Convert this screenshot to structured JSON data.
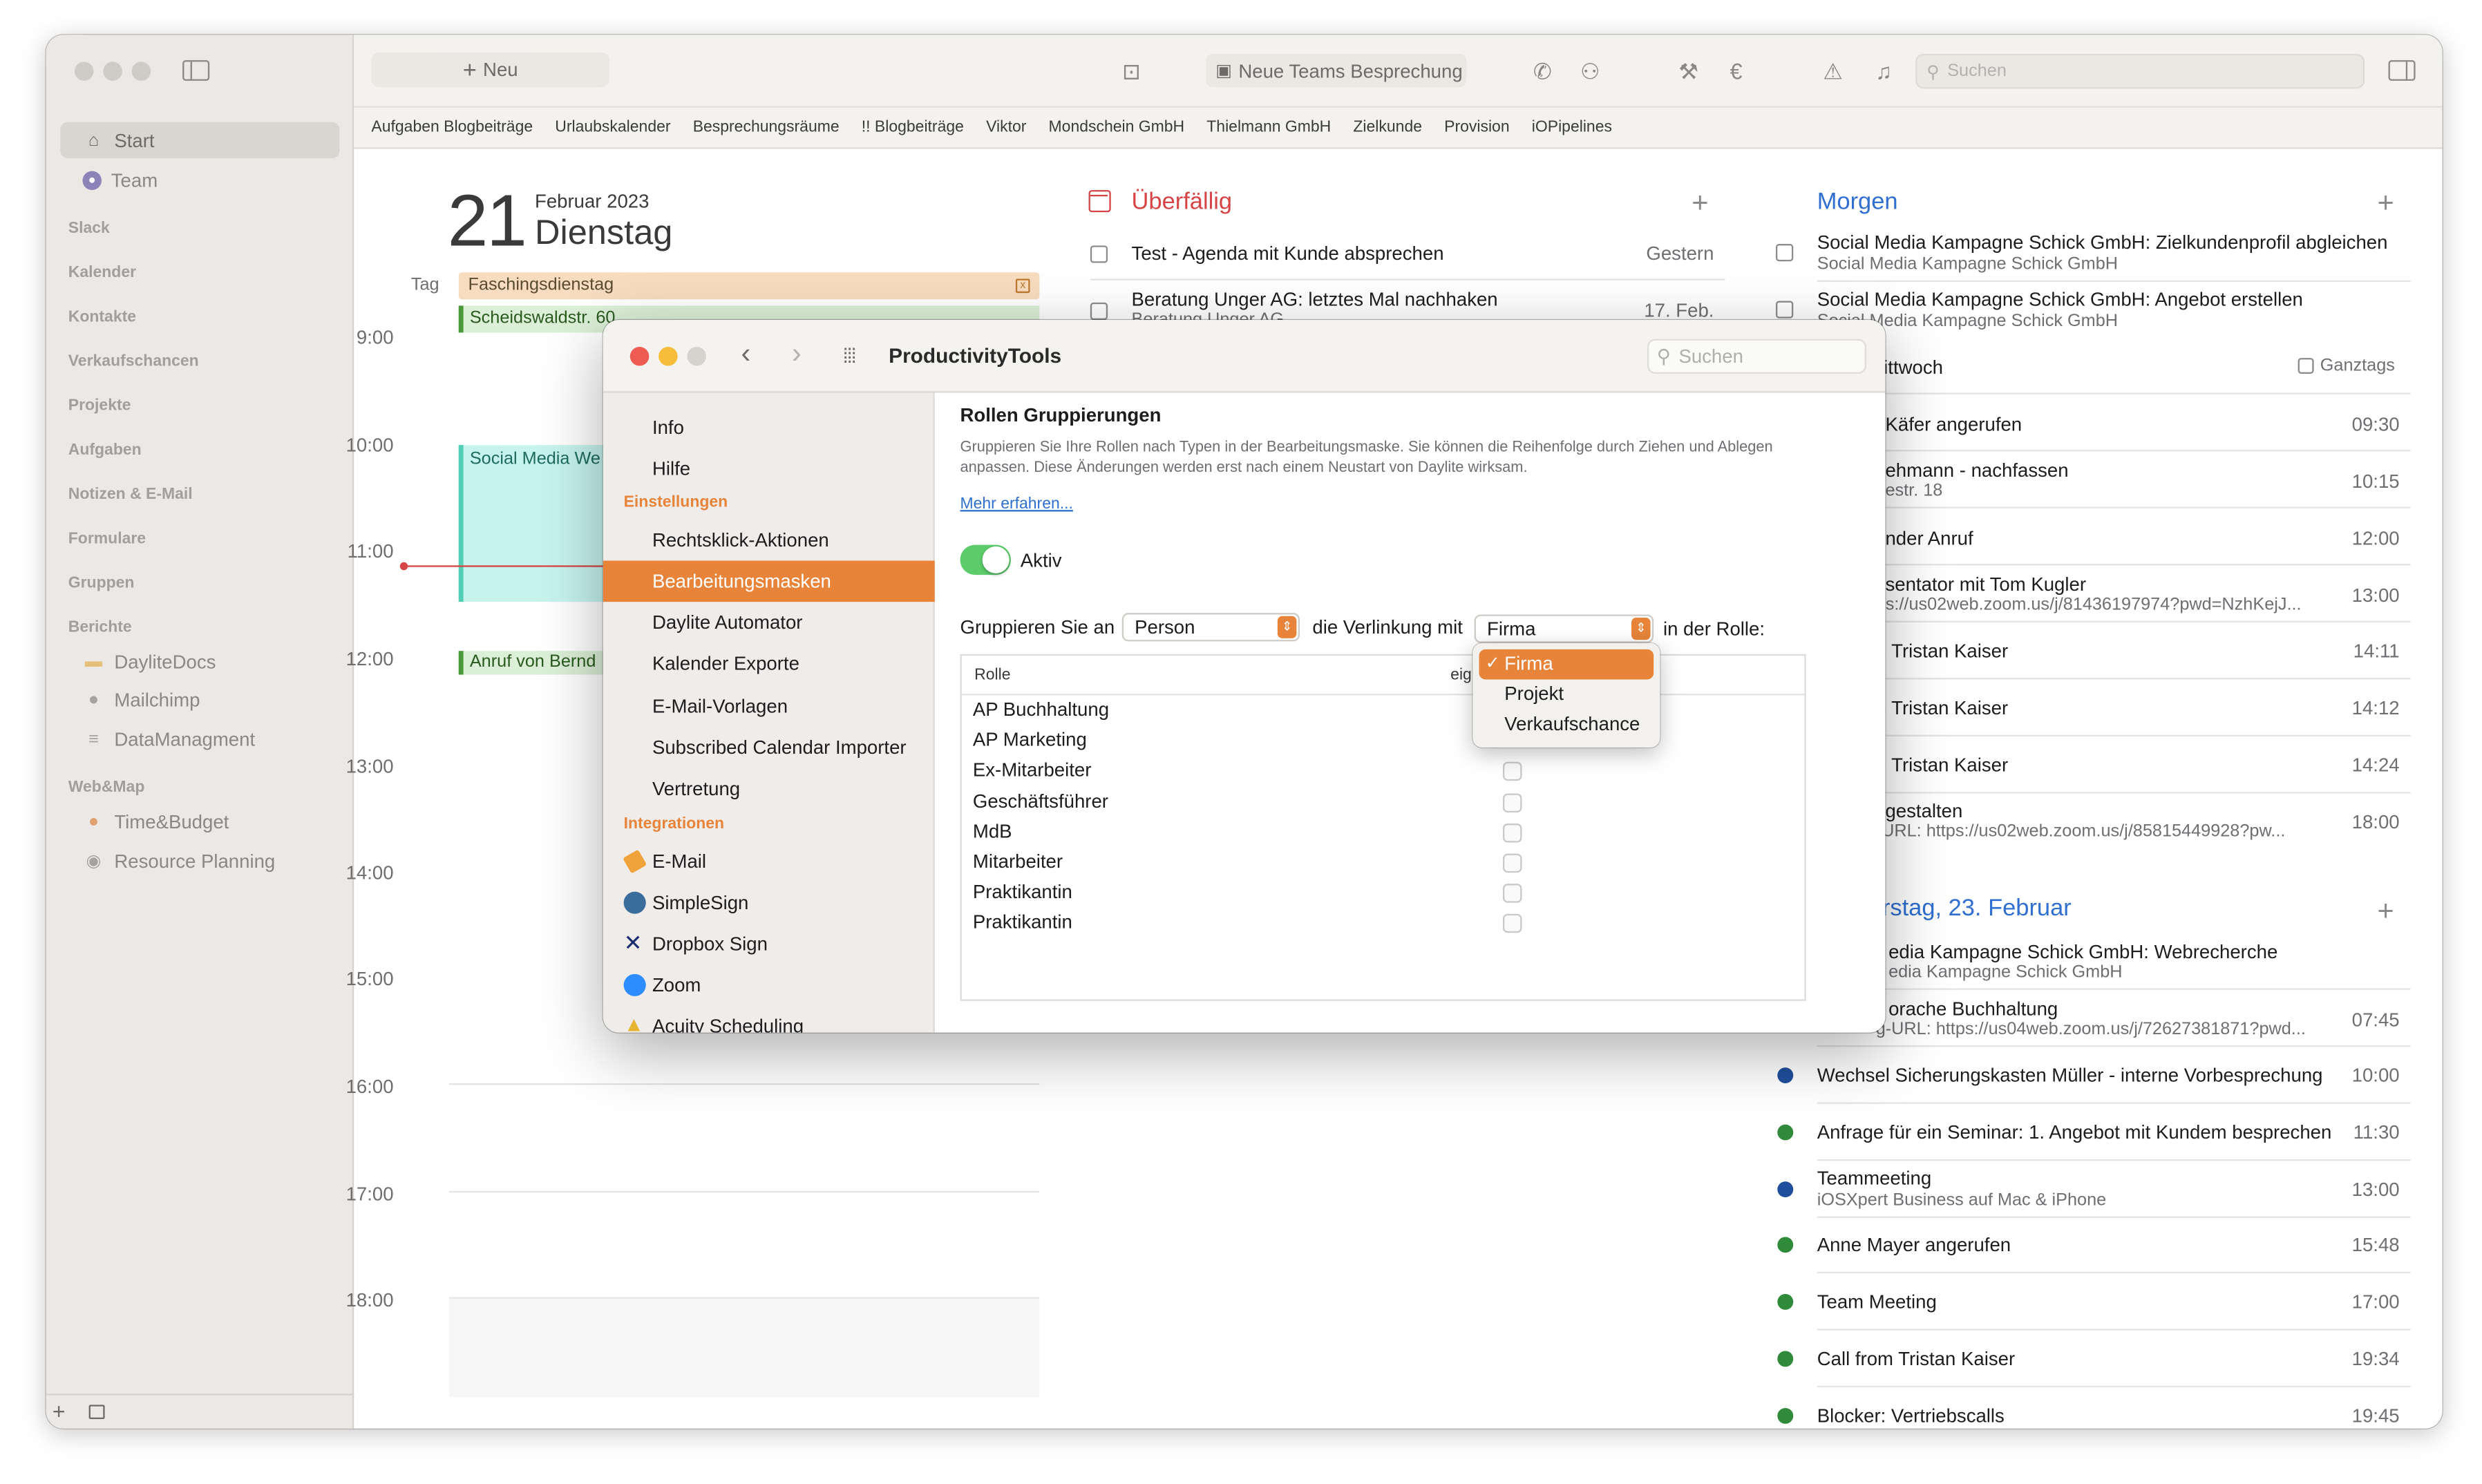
{
  "app": {
    "new_button": "Neu",
    "teams_button": "Neue Teams Besprechung",
    "search_placeholder": "Suchen"
  },
  "sidebar": {
    "items": [
      {
        "label": "Start",
        "icon": "house-icon"
      },
      {
        "label": "Team",
        "icon": "team-icon"
      }
    ],
    "headers": [
      "Slack",
      "Kalender",
      "Kontakte",
      "Verkaufschancen",
      "Projekte",
      "Aufgaben",
      "Notizen & E-Mail",
      "Formulare",
      "Gruppen",
      "Berichte"
    ],
    "reports": [
      "DayliteDocs",
      "Mailchimp",
      "DataManagment"
    ],
    "webmap_header": "Web&Map",
    "webmap": [
      "Time&Budget",
      "Resource Planning"
    ]
  },
  "favorites": [
    "Aufgaben Blogbeiträge",
    "Urlaubskalender",
    "Besprechungsräume",
    "!! Blogbeiträge",
    "Viktor",
    "Mondschein GmbH",
    "Thielmann GmbH",
    "Zielkunde",
    "Provision",
    "iOPipelines"
  ],
  "calendar": {
    "day_number": "21",
    "month_year": "Februar 2023",
    "weekday": "Dienstag",
    "tag_label": "Tag",
    "allday_event": "Faschingsdienstag",
    "event_address": "Scheidswaldstr. 60",
    "event_social": "Social Media We",
    "event_call": "Anruf von Bernd",
    "hours": [
      "9:00",
      "10:00",
      "11:00",
      "12:00",
      "13:00",
      "14:00",
      "15:00",
      "16:00",
      "17:00",
      "18:00"
    ]
  },
  "overdue": {
    "title": "Überfällig",
    "items": [
      {
        "label": "Test - Agenda mit Kunde absprechen",
        "date": "Gestern"
      },
      {
        "label": "Beratung Unger AG: letztes Mal nachhaken",
        "sub": "Beratung Unger AG",
        "date": "17. Feb."
      }
    ]
  },
  "tomorrow": {
    "title": "Morgen",
    "tasks": [
      {
        "label": "Social Media Kampagne Schick GmbH: Zielkundenprofil abgleichen",
        "sub": "Social Media Kampagne Schick GmbH"
      },
      {
        "label": "Social Media Kampagne Schick GmbH: Angebot erstellen",
        "sub": "Social Media Kampagne Schick GmbH"
      }
    ],
    "wed_header": "ittwoch",
    "ganztags": "Ganztags",
    "partial": [
      {
        "label": "Käfer angerufen",
        "time": "09:30"
      },
      {
        "label": "ehmann - nachfassen",
        "sub": "estr. 18",
        "time": "10:15"
      },
      {
        "label": "nder Anruf",
        "time": "12:00"
      },
      {
        "label": "sentator mit Tom Kugler",
        "sub": "ps://us02web.zoom.us/j/81436197974?pwd=NzhKejJ...",
        "time": "13:00"
      },
      {
        "label": "n Tristan Kaiser",
        "time": "14:11"
      },
      {
        "label": "n Tristan Kaiser",
        "time": "14:12"
      },
      {
        "label": "n Tristan Kaiser",
        "time": "14:24"
      },
      {
        "label": "gestalten",
        "sub": "-URL: https://us02web.zoom.us/j/85815449928?pw...",
        "time": "18:00"
      }
    ],
    "thu_header": "rstag, 23. Februar",
    "thu_partial": [
      {
        "label": "edia Kampagne Schick GmbH: Webrecherche",
        "sub": "edia Kampagne Schick GmbH"
      },
      {
        "label": "orache Buchhaltung",
        "sub": "g-URL: https://us04web.zoom.us/j/72627381871?pwd...",
        "time": "07:45"
      }
    ],
    "events": [
      {
        "label": "Wechsel Sicherungskasten Müller - interne Vorbesprechung",
        "time": "10:00",
        "color": "#1f4f9c"
      },
      {
        "label": "Anfrage für ein Seminar: 1. Angebot mit Kundem besprechen",
        "time": "11:30",
        "color": "#2f8a3a"
      },
      {
        "label": "Teammeeting",
        "sub": "iOSXpert Business auf Mac & iPhone",
        "time": "13:00",
        "color": "#1f4f9c"
      },
      {
        "label": "Anne Mayer angerufen",
        "time": "15:48",
        "color": "#2f8a3a"
      },
      {
        "label": "Team Meeting",
        "time": "17:00",
        "color": "#2f8a3a"
      },
      {
        "label": "Call from Tristan Kaiser",
        "time": "19:34",
        "color": "#2f8a3a"
      },
      {
        "label": "Blocker: Vertriebscalls",
        "time": "19:45",
        "color": "#2f8a3a"
      }
    ]
  },
  "dialog": {
    "title": "ProductivityTools",
    "search_placeholder": "Suchen",
    "nav": [
      {
        "label": "Info"
      },
      {
        "label": "Hilfe"
      }
    ],
    "settings_header": "Einstellungen",
    "settings": [
      "Rechtsklick-Aktionen",
      "Bearbeitungsmasken",
      "Daylite Automator",
      "Kalender Exporte",
      "E-Mail-Vorlagen",
      "Subscribed Calendar Importer",
      "Vertretung"
    ],
    "integrations_header": "Integrationen",
    "integrations": [
      {
        "label": "E-Mail",
        "icon": "paper-plane-icon",
        "color": "#f0a33a"
      },
      {
        "label": "SimpleSign",
        "icon": "simplesign-icon",
        "color": "#3a6c9c"
      },
      {
        "label": "Dropbox Sign",
        "icon": "dropbox-sign-icon",
        "color": "#1a2a6c"
      },
      {
        "label": "Zoom",
        "icon": "zoom-icon",
        "color": "#2d8cff"
      },
      {
        "label": "Acuity Scheduling",
        "icon": "acuity-icon",
        "color": "#e8b430"
      }
    ],
    "section_title": "Rollen Gruppierungen",
    "description": "Gruppieren Sie Ihre Rollen nach Typen in der Bearbeitungsmaske. Sie können die Reihenfolge durch Ziehen und Ablegen anpassen. Diese Änderungen werden erst nach einem Neustart von Daylite wirksam.",
    "learn_more": "Mehr erfahren...",
    "toggle_label": "Aktiv",
    "toggle_on": true,
    "group_label": "Gruppieren Sie an",
    "group_value": "Person",
    "link_label": "die Verlinkung mit",
    "link_value": "Firma",
    "role_label": "in der Rolle:",
    "table_header": "Rolle",
    "table_header2": "eig",
    "roles": [
      "AP Buchhaltung",
      "AP Marketing",
      "Ex-Mitarbeiter",
      "Geschäftsführer",
      "MdB",
      "Mitarbeiter",
      "Praktikantin",
      "Praktikantin"
    ],
    "dropdown_options": [
      {
        "label": "Firma",
        "checked": true
      },
      {
        "label": "Projekt"
      },
      {
        "label": "Verkaufschance"
      }
    ]
  },
  "colors": {
    "accent": "#e7843a",
    "overdue": "#d64545",
    "morgen": "#2f6fd0",
    "toggle": "#5ccc6a"
  }
}
